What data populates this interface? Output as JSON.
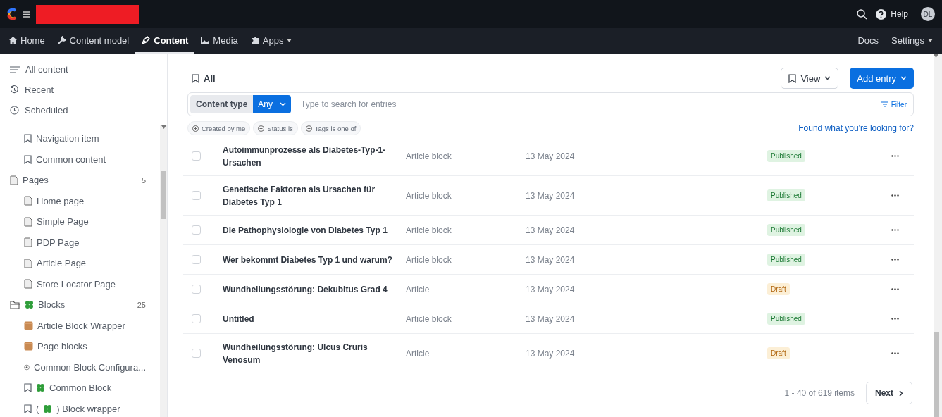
{
  "top_bar": {
    "help": "Help",
    "avatar": "DL"
  },
  "nav": {
    "tabs": [
      {
        "label": "Home",
        "kind": "home",
        "selected": false
      },
      {
        "label": "Content model",
        "kind": "wrench",
        "selected": false
      },
      {
        "label": "Content",
        "kind": "pen",
        "selected": true
      },
      {
        "label": "Media",
        "kind": "image",
        "selected": false
      },
      {
        "label": "Apps",
        "kind": "puzzle",
        "selected": false,
        "dropdown": true
      }
    ],
    "right": [
      {
        "label": "Docs",
        "dropdown": false
      },
      {
        "label": "Settings",
        "dropdown": true
      }
    ]
  },
  "sidebar": {
    "views": [
      {
        "label": "All content",
        "kind": "lines"
      },
      {
        "label": "Recent",
        "kind": "history"
      },
      {
        "label": "Scheduled",
        "kind": "clock"
      }
    ],
    "tree_continued": [
      {
        "label": "Navigation item",
        "kind": "bookmark"
      },
      {
        "label": "Common content",
        "kind": "bookmark"
      }
    ],
    "tree": [
      {
        "label": "Pages",
        "kind": "page",
        "count": "5",
        "children": [
          {
            "label": "Home page",
            "kind": "page"
          },
          {
            "label": "Simple Page",
            "kind": "page"
          },
          {
            "label": "PDP Page",
            "kind": "page"
          },
          {
            "label": "Article Page",
            "kind": "page"
          },
          {
            "label": "Store Locator Page",
            "kind": "page"
          }
        ]
      },
      {
        "label": "Blocks",
        "kind": "folder",
        "clover": true,
        "count": "25",
        "children": [
          {
            "label": "Article Block Wrapper",
            "kind": "block"
          },
          {
            "label": "Page blocks",
            "kind": "block"
          },
          {
            "label": "Common Block Configura...",
            "kind": "gear"
          },
          {
            "label": "Common Block",
            "kind": "bookmark",
            "clover": true
          },
          {
            "label": ") Block wrapper",
            "label_before": "(",
            "kind": "bookmark",
            "clover": true
          }
        ]
      }
    ]
  },
  "main": {
    "title": "All",
    "view_button": "View",
    "add_button": "Add entry",
    "search": {
      "content_type_label": "Content type",
      "content_type_value": "Any",
      "placeholder": "Type to search for entries",
      "filter": "Filter"
    },
    "chips": [
      "Created by me",
      "Status is",
      "Tags is one of"
    ],
    "found_link": "Found what you're looking for?",
    "rows": [
      {
        "title": "Autoimmunprozesse als Diabetes-Typ-1-Ursachen",
        "type": "Article block",
        "date": "13 May 2024",
        "status": {
          "label": "Published",
          "kind": "published"
        },
        "checked": false
      },
      {
        "title": "Genetische Faktoren als Ursachen für Diabetes Typ 1",
        "type": "Article block",
        "date": "13 May 2024",
        "status": {
          "label": "Published",
          "kind": "published"
        },
        "checked": false
      },
      {
        "title": "Die Pathophysiologie von Diabetes Typ 1",
        "type": "Article block",
        "date": "13 May 2024",
        "status": {
          "label": "Published",
          "kind": "published"
        },
        "checked": false
      },
      {
        "title": "Wer bekommt Diabetes Typ 1 und warum?",
        "type": "Article block",
        "date": "13 May 2024",
        "status": {
          "label": "Published",
          "kind": "published"
        },
        "checked": false
      },
      {
        "title": "Wundheilungsstörung: Dekubitus Grad 4",
        "type": "Article",
        "date": "13 May 2024",
        "status": {
          "label": "Draft",
          "kind": "draft"
        },
        "checked": false
      },
      {
        "title": "Untitled",
        "type": "Article block",
        "date": "13 May 2024",
        "status": {
          "label": "Published",
          "kind": "published"
        },
        "checked": false
      },
      {
        "title": "Wundheilungsstörung: Ulcus Cruris Venosum",
        "type": "Article",
        "date": "13 May 2024",
        "status": {
          "label": "Draft",
          "kind": "draft"
        },
        "checked": false
      }
    ],
    "pagination": {
      "range": "1 - 40 of 619 items",
      "next": "Next"
    }
  }
}
